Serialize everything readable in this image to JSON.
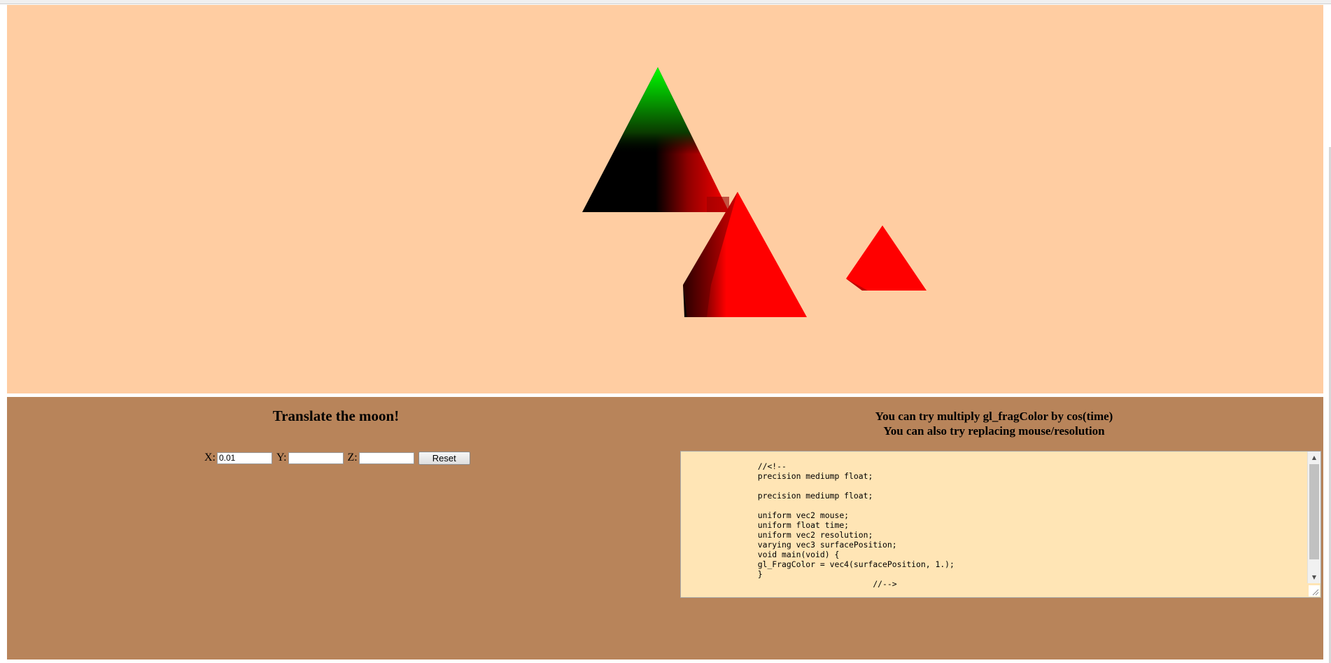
{
  "canvas": {
    "background": "#ffcda2",
    "shapes": [
      {
        "name": "pyramid-large",
        "colors": [
          "#00ff00",
          "#000000",
          "#ff0000"
        ]
      },
      {
        "name": "pyramid-center",
        "colors": [
          "#ff0000",
          "#000000"
        ]
      },
      {
        "name": "moon-pyramid",
        "colors": [
          "#ff0000"
        ]
      }
    ]
  },
  "controls": {
    "background": "#b8845a",
    "title": "Translate the moon!",
    "x_label": "X:",
    "x_value": "0.01",
    "y_label": "Y:",
    "y_value": "",
    "z_label": "Z:",
    "z_value": "",
    "reset_label": "Reset"
  },
  "shader": {
    "hint_1": "You can try multiply gl_fragColor by cos(time)",
    "hint_2": "You can also try replacing mouse/resolution",
    "code_background": "#ffe5b5",
    "code": "\n\t\t//<!--\n\t\tprecision mediump float;\n\n\t\tprecision mediump float;\n\n\t\tuniform vec2 mouse;\n\t\tuniform float time;\n\t\tuniform vec2 resolution;\n\t\tvarying vec3 surfacePosition;\n\t\tvoid main(void) {\n\t\tgl_FragColor = vec4(surfacePosition, 1.);\n\t\t}\n\t\t\t\t\t//-->"
  },
  "icons": {
    "scroll_up": "▲",
    "scroll_down": "▼"
  }
}
